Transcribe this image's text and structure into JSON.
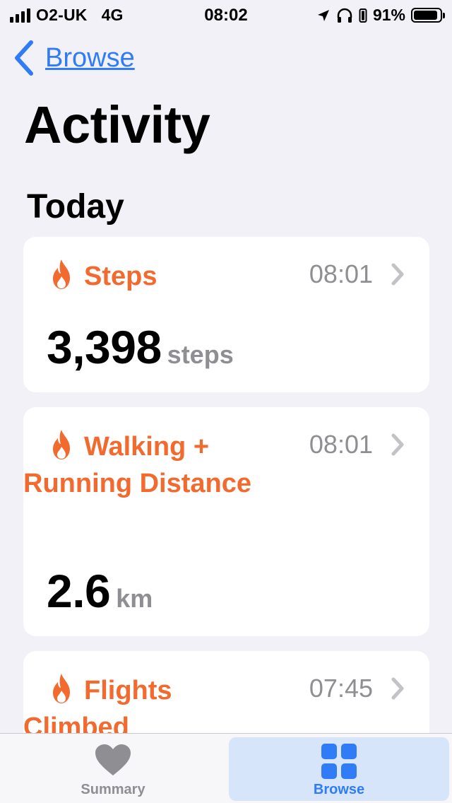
{
  "status_bar": {
    "carrier": "O2-UK",
    "network": "4G",
    "time": "08:02",
    "battery_percent": "91%",
    "battery_level": 0.91
  },
  "nav": {
    "back_label": "Browse",
    "title": "Activity"
  },
  "section": {
    "title": "Today"
  },
  "cards": [
    {
      "title": "Steps",
      "time": "08:01",
      "value": "3,398",
      "unit": "steps",
      "icon": "flame-icon"
    },
    {
      "title": "Walking + Running Distance",
      "time": "08:01",
      "value": "2.6",
      "unit": "km",
      "icon": "flame-icon"
    },
    {
      "title": "Flights Climbed",
      "time": "07:45",
      "icon": "flame-icon"
    }
  ],
  "tab_bar": {
    "tabs": [
      {
        "label": "Summary",
        "icon": "heart-icon",
        "selected": false
      },
      {
        "label": "Browse",
        "icon": "grid-icon",
        "selected": true
      }
    ]
  },
  "colors": {
    "accent": "#2f7cf6",
    "activity": "#f26a2e",
    "secondary_text": "#8e8e93",
    "background": "#f2f1f7"
  }
}
